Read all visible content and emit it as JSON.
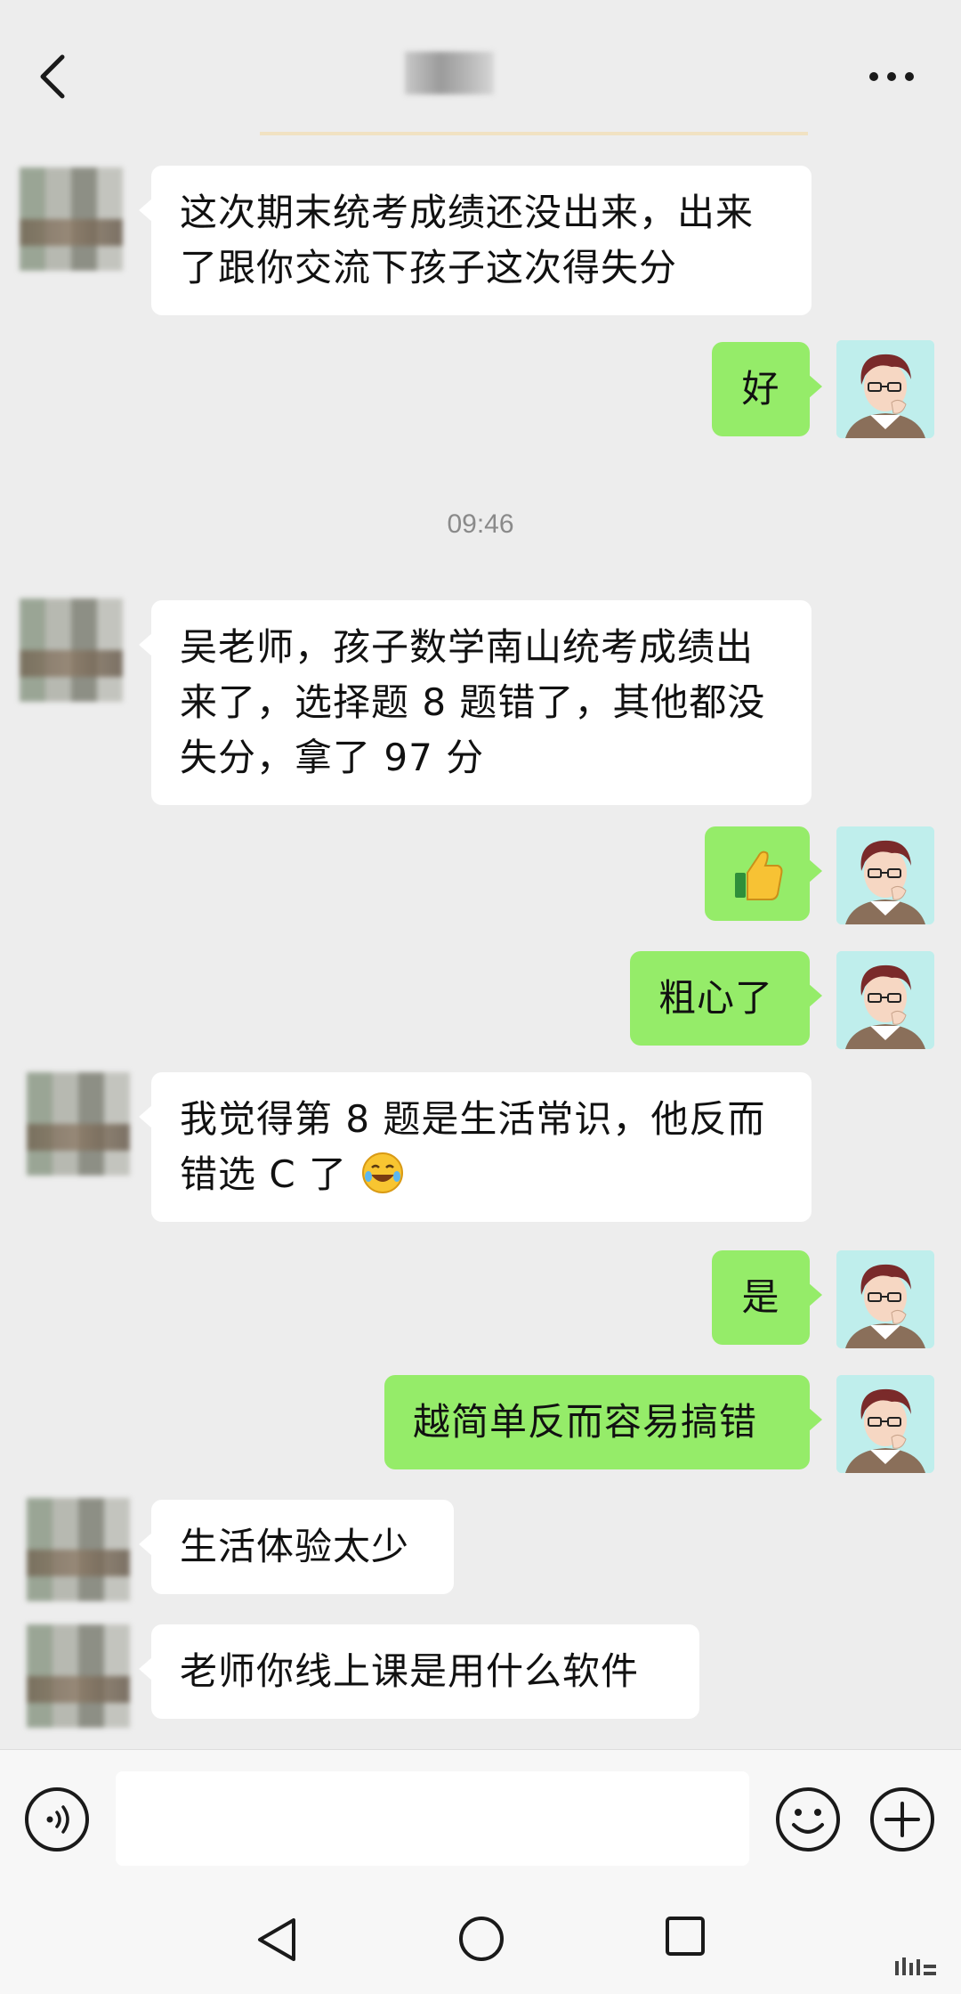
{
  "header": {
    "back_icon": "chevron-left-icon",
    "more_icon": "more-horizontal-icon"
  },
  "messages": [
    {
      "side": "left",
      "lines": [
        "这次期末统考成绩还没出来，出来",
        "了跟你交流下孩子这次得失分"
      ]
    },
    {
      "side": "right",
      "lines": [
        "好"
      ]
    },
    {
      "type": "time",
      "text": "09:46"
    },
    {
      "side": "left",
      "lines": [
        "吴老师，孩子数学南山统考成绩出",
        "来了，选择题 8 题错了，其他都没",
        "失分，拿了 97 分"
      ]
    },
    {
      "side": "right",
      "emoji": "thumbs-up-icon"
    },
    {
      "side": "right",
      "lines": [
        "粗心了"
      ]
    },
    {
      "side": "left",
      "lines": [
        "我觉得第 8 题是生活常识，他反而",
        "错选 C 了"
      ],
      "trailing_emoji": "laughing-crying-icon"
    },
    {
      "side": "right",
      "lines": [
        "是"
      ]
    },
    {
      "side": "right",
      "lines": [
        "越简单反而容易搞错"
      ]
    },
    {
      "side": "left",
      "lines": [
        "生活体验太少"
      ]
    },
    {
      "side": "left",
      "lines": [
        "老师你线上课是用什么软件"
      ]
    }
  ],
  "msg": {
    "m1_l1": "这次期末统考成绩还没出来，出来",
    "m1_l2": "了跟你交流下孩子这次得失分",
    "m2": "好",
    "time": "09:46",
    "m3_l1": "吴老师，孩子数学南山统考成绩出",
    "m3_l2": "来了，选择题 8 题错了，其他都没",
    "m3_l3": "失分，拿了 97 分",
    "m5": "粗心了",
    "m6_l1": "我觉得第 8 题是生活常识，他反而",
    "m6_l2": "错选 C 了",
    "m7": "是",
    "m8": "越简单反而容易搞错",
    "m9": "生活体验太少",
    "m10": "老师你线上课是用什么软件"
  },
  "input_bar": {
    "voice_icon": "voice-icon",
    "text_value": "",
    "emoji_icon": "emoji-icon",
    "plus_icon": "plus-icon"
  },
  "nav_bar": {
    "back_icon": "nav-back-icon",
    "home_icon": "nav-home-icon",
    "recent_icon": "nav-recent-icon"
  },
  "colors": {
    "background": "#ededed",
    "bubble_self": "#95ec69",
    "bubble_other": "#ffffff",
    "time_text": "#8a8a8a"
  }
}
